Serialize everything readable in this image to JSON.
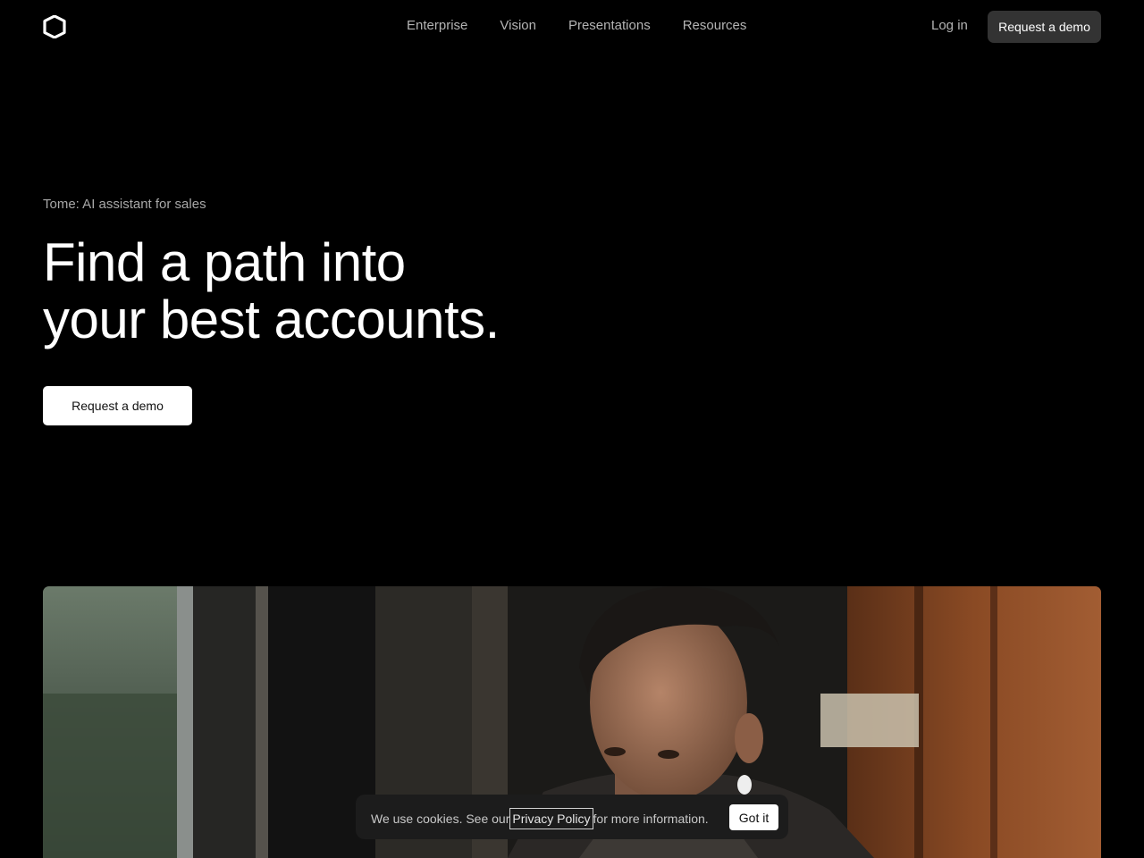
{
  "nav": {
    "logo_icon": "tome-logo-icon",
    "links": [
      {
        "label": "Enterprise"
      },
      {
        "label": "Vision"
      },
      {
        "label": "Presentations"
      },
      {
        "label": "Resources"
      }
    ],
    "login_label": "Log in",
    "demo_label": "Request a demo"
  },
  "hero": {
    "eyebrow": "Tome: AI assistant for sales",
    "title_lines": [
      "Find a path into",
      "your best accounts."
    ],
    "cta_label": "Request a demo",
    "media_icon": "salesperson-photo"
  },
  "cookie": {
    "text_before": "We use cookies. See our",
    "link_label": "Privacy Policy",
    "text_after": "for more information.",
    "button_label": "Got it"
  },
  "colors": {
    "background": "#000000",
    "nav_text": "#b4b4b4",
    "nav_button_bg": "#333333",
    "cta_bg": "#ffffff",
    "banner_bg": "#1c1c1c"
  }
}
